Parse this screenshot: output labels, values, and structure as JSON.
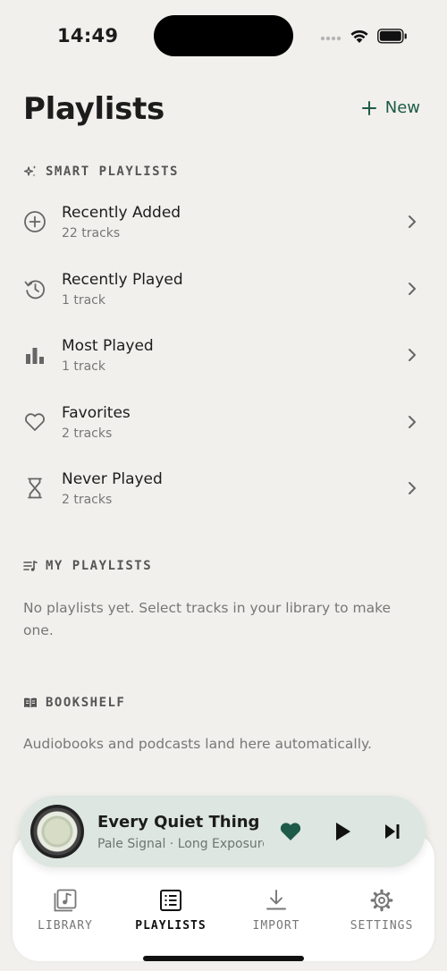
{
  "status": {
    "time": "14:49"
  },
  "header": {
    "title": "Playlists",
    "new_label": "New"
  },
  "smart": {
    "heading": "SMART PLAYLISTS",
    "items": [
      {
        "title": "Recently Added",
        "count": "22 tracks",
        "icon": "plus-circle-icon"
      },
      {
        "title": "Recently Played",
        "count": "1 track",
        "icon": "history-icon"
      },
      {
        "title": "Most Played",
        "count": "1 track",
        "icon": "bar-chart-icon"
      },
      {
        "title": "Favorites",
        "count": "2 tracks",
        "icon": "heart-outline-icon"
      },
      {
        "title": "Never Played",
        "count": "2 tracks",
        "icon": "hourglass-icon"
      }
    ]
  },
  "my_playlists": {
    "heading": "MY PLAYLISTS",
    "empty": "No playlists yet. Select tracks in your library to make one."
  },
  "bookshelf": {
    "heading": "BOOKSHELF",
    "empty": "Audiobooks and podcasts land here automatically."
  },
  "now_playing": {
    "title": "Every Quiet Thing",
    "artist": "Pale Signal · Long Exposure",
    "favorited": true
  },
  "tabs": [
    {
      "label": "LIBRARY",
      "icon": "music-library-icon",
      "active": false
    },
    {
      "label": "PLAYLISTS",
      "icon": "playlist-icon",
      "active": true
    },
    {
      "label": "IMPORT",
      "icon": "download-icon",
      "active": false
    },
    {
      "label": "SETTINGS",
      "icon": "gear-icon",
      "active": false
    }
  ],
  "colors": {
    "accent": "#1e5a48",
    "background": "#f1f0ec",
    "player": "#dde6e1"
  }
}
